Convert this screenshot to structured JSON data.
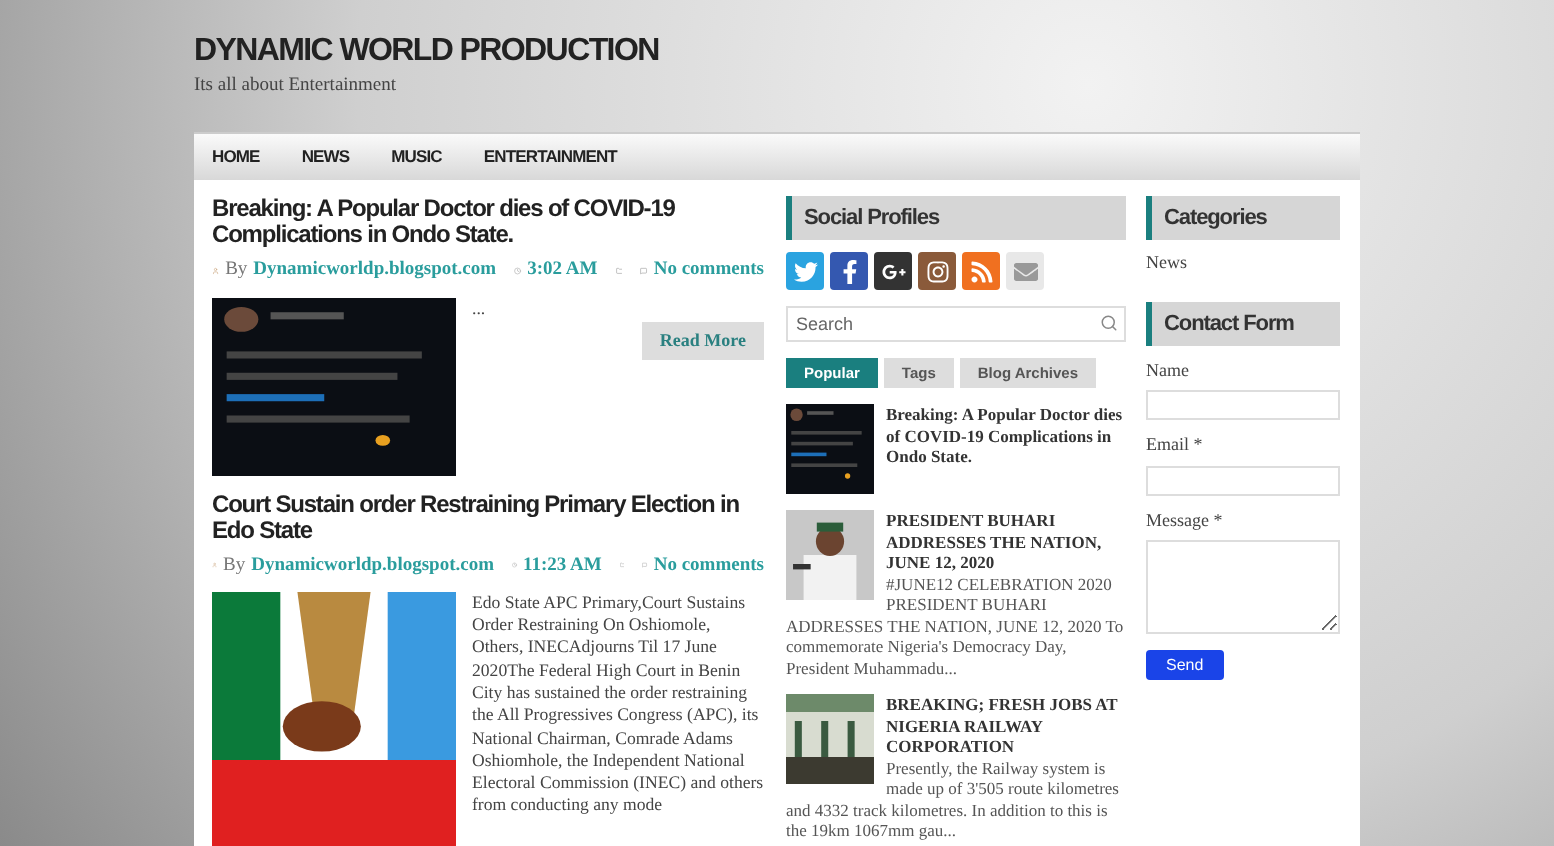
{
  "site": {
    "title": "DYNAMIC WORLD PRODUCTION",
    "tagline": "Its all about Entertainment"
  },
  "nav": [
    {
      "label": "HOME"
    },
    {
      "label": "NEWS"
    },
    {
      "label": "MUSIC"
    },
    {
      "label": "ENTERTAINMENT"
    }
  ],
  "posts": [
    {
      "title": "Breaking: A Popular Doctor dies of COVID-19 Complications in Ondo State.",
      "by": "By",
      "author": "Dynamicworldp.blogspot.com",
      "time": "3:02 AM",
      "comments": "No comments",
      "snippet": "...",
      "read_more": "Read More"
    },
    {
      "title": "Court Sustain order Restraining Primary Election in Edo State",
      "by": "By",
      "author": "Dynamicworldp.blogspot.com",
      "time": "11:23 AM",
      "comments": "No comments",
      "snippet": "Edo State APC Primary,Court Sustains Order Restraining On Oshiomole, Others, INECAdjourns Til 17 June 2020The Federal High Court in Benin City has sustained the order restraining the All Progressives Congress (APC), its National Chairman, Comrade Adams Oshiomhole, the Independent National Electoral Commission (INEC) and others from conducting any mode"
    }
  ],
  "social": {
    "title": "Social Profiles"
  },
  "search": {
    "placeholder": "Search"
  },
  "tabs": [
    {
      "label": "Popular",
      "selected": true
    },
    {
      "label": "Tags",
      "selected": false
    },
    {
      "label": "Blog Archives",
      "selected": false
    }
  ],
  "popular": [
    {
      "title": "Breaking: A Popular Doctor dies of COVID-19 Complications in Ondo State."
    },
    {
      "title": "PRESIDENT BUHARI ADDRESSES THE NATION, JUNE 12, 2020",
      "snippet": "#JUNE12 CELEBRATION 2020 PRESIDENT BUHARI ADDRESSES THE NATION, JUNE 12, 2020 To commemorate Nigeria's Democracy Day, President Muhammadu..."
    },
    {
      "title": "BREAKING; FRESH JOBS AT NIGERIA RAILWAY CORPORATION",
      "snippet": "Presently, the Railway system is made up of 3'505 route kilometres and 4332 track kilometres. In addition to this is the 19km 1067mm gau..."
    }
  ],
  "categories": {
    "title": "Categories",
    "items": [
      "News"
    ]
  },
  "contact": {
    "title": "Contact Form",
    "fields": [
      {
        "label": "Name",
        "kind": "text"
      },
      {
        "label": "Email *",
        "kind": "text"
      },
      {
        "label": "Message *",
        "kind": "textarea"
      }
    ],
    "button": "Send"
  }
}
